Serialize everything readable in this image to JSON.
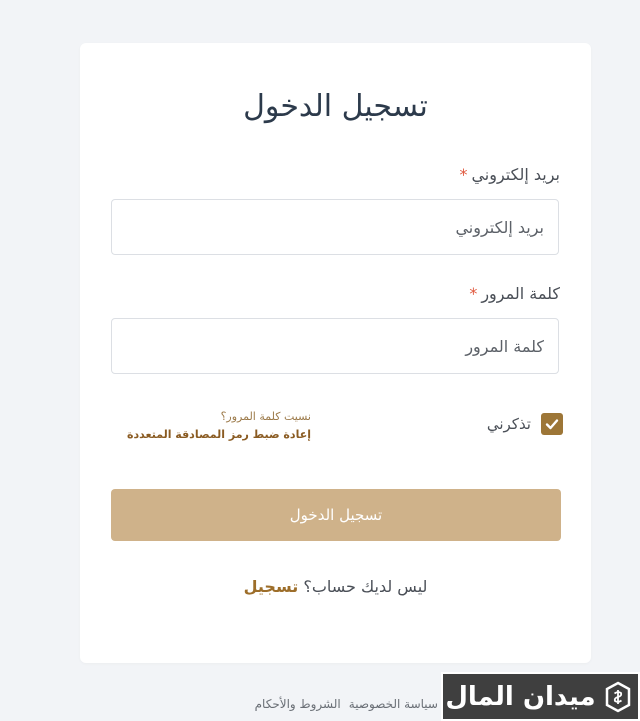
{
  "login": {
    "title": "تسجيل الدخول",
    "email": {
      "label": "بريد إلكتروني",
      "required_mark": "*",
      "placeholder": "بريد إلكتروني",
      "value": ""
    },
    "password": {
      "label": "كلمة المرور",
      "required_mark": "*",
      "placeholder": "كلمة المرور",
      "value": ""
    },
    "remember_me": {
      "label": "تذكرني",
      "checked": true
    },
    "forgot_password": "نسيت كلمة المرور؟",
    "reset_mfa": "إعادة ضبط رمز المصادقة المتعددة",
    "submit_label": "تسجيل الدخول",
    "signup_prompt": "ليس لديك حساب؟",
    "signup_link": "تسجيل"
  },
  "footer": {
    "privacy": "سياسة الخصوصية",
    "terms": "الشروط والأحكام"
  },
  "watermark": {
    "text": "ميدان المال"
  },
  "colors": {
    "accent": "#9d7637",
    "button": "#cfb28a",
    "required": "#e0593f",
    "background": "#f2f4f7"
  }
}
